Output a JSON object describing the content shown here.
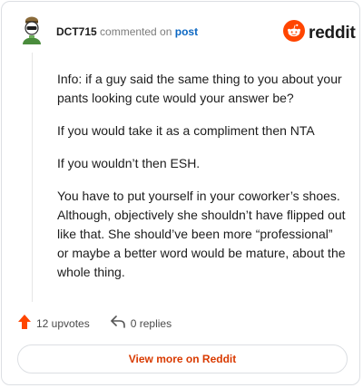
{
  "header": {
    "username": "DCT715",
    "commented_on": "commented on",
    "post_link": "post",
    "brand": "reddit"
  },
  "comment": {
    "paragraphs": [
      "Info: if a guy said the same thing to you about your pants looking cute would your answer be?",
      "If you would take it as a compliment then NTA",
      "If you wouldn’t then ESH.",
      "You have to put yourself in your coworker’s shoes. Although, objectively she shouldn’t have flipped out like that. She should’ve been more “professional” or maybe a better word would be mature, about the whole thing."
    ]
  },
  "actions": {
    "upvotes": "12 upvotes",
    "replies": "0 replies"
  },
  "footer": {
    "view_more": "View more on Reddit"
  },
  "icons": {
    "upvote": "upvote-arrow-icon",
    "reply": "reply-arrow-icon",
    "brand": "reddit-snoo-icon",
    "avatar": "user-avatar"
  },
  "colors": {
    "accent": "#ff4500",
    "link": "#0a66c2",
    "button_text": "#d93a00"
  }
}
